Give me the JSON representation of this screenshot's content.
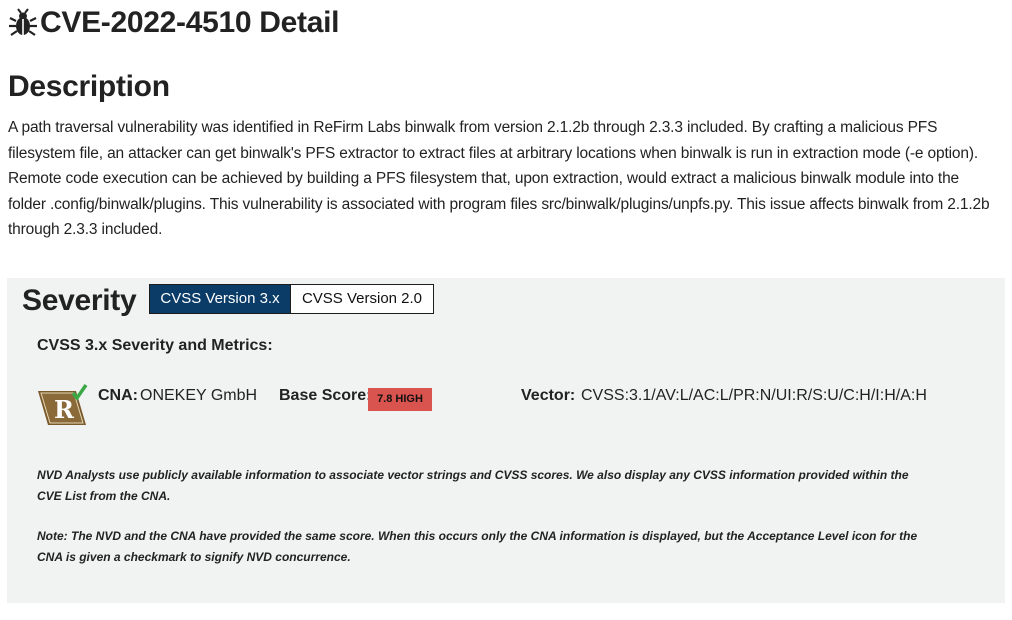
{
  "header": {
    "title": "CVE-2022-4510 Detail",
    "icon": "bug-icon"
  },
  "description": {
    "heading": "Description",
    "text": "A path traversal vulnerability was identified in ReFirm Labs binwalk from version 2.1.2b through 2.3.3 included. By crafting a malicious PFS filesystem file, an attacker can get binwalk's PFS extractor to extract files at arbitrary locations when binwalk is run in extraction mode (-e option). Remote code execution can be achieved by building a PFS filesystem that, upon extraction, would extract a malicious binwalk module into the folder .config/binwalk/plugins. This vulnerability is associated with program files src/binwalk/plugins/unpfs.py. This issue affects binwalk from 2.1.2b through 2.3.3 included."
  },
  "severity": {
    "heading": "Severity",
    "tabs": [
      {
        "label": "CVSS Version 3.x",
        "active": true
      },
      {
        "label": "CVSS Version 2.0",
        "active": false
      }
    ],
    "metrics_heading": "CVSS 3.x Severity and Metrics:",
    "cna_label": "CNA:",
    "cna_value": "ONEKEY GmbH",
    "base_score_label": "Base Score:",
    "base_score_value": "7.8 HIGH",
    "vector_label": "Vector:",
    "vector_value": "CVSS:3.1/AV:L/AC:L/PR:N/UI:R/S:U/C:H/I:H/A:H",
    "acceptance_icon_letter": "R",
    "note1": "NVD Analysts use publicly available information to associate vector strings and CVSS scores. We also display any CVSS information provided within the CVE List from the CNA.",
    "note2": "Note: The NVD and the CNA have provided the same score. When this occurs only the CNA information is displayed, but the Acceptance Level icon for the CNA is given a checkmark to signify NVD concurrence."
  },
  "colors": {
    "tab_active_bg": "#0a3c67",
    "badge_high": "#d9534f",
    "panel_bg": "#f1f3f2",
    "icon_brown": "#7a5a2c",
    "checkmark": "#3aa845"
  }
}
